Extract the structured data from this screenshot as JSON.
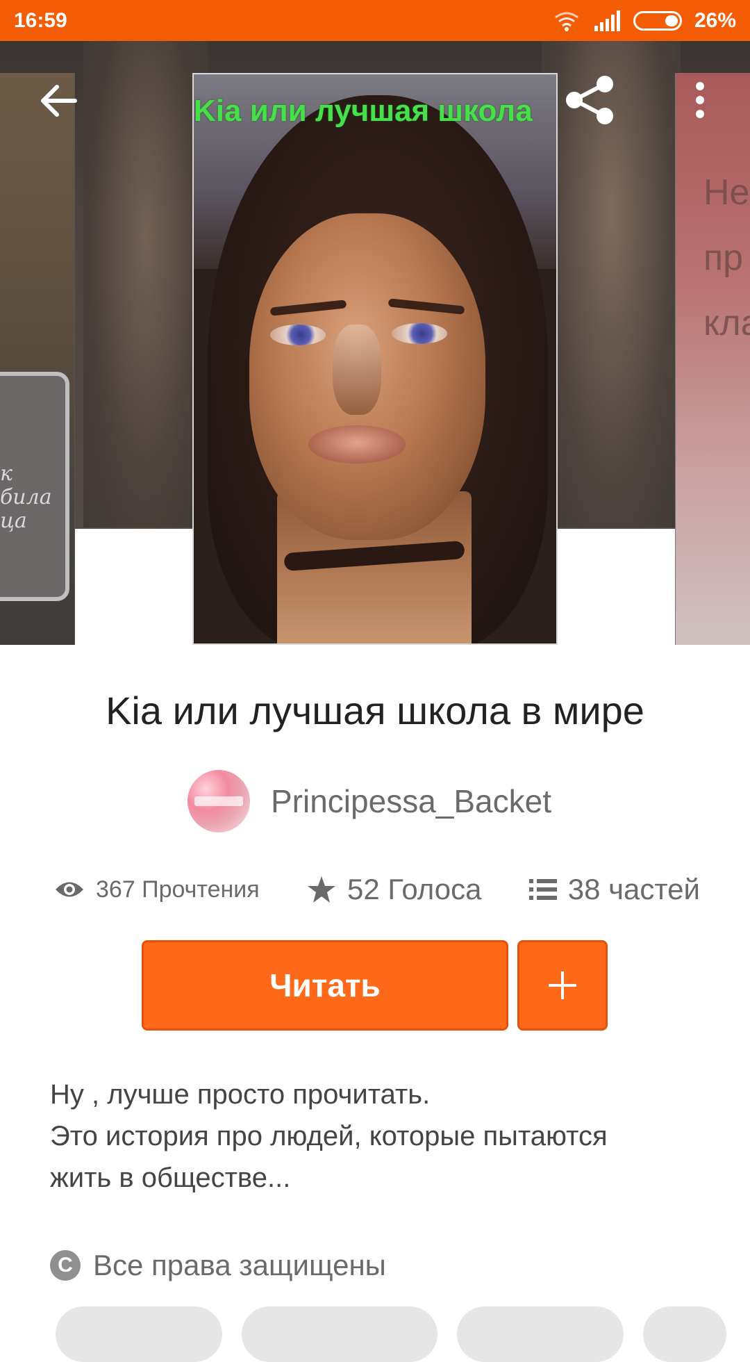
{
  "status_bar": {
    "time": "16:59",
    "battery": "26%"
  },
  "cover": {
    "title_text": "Kia или лучшая школа",
    "left_cover_text": [
      "к",
      "била",
      "ца"
    ],
    "right_cover_text": [
      "Не",
      "пр",
      "кла"
    ]
  },
  "book": {
    "title": "Kia или лучшая школа в мире",
    "author": "Principessa_Backet"
  },
  "stats": {
    "reads": "367 Прочтения",
    "votes": "52 Голоса",
    "parts": "38 частей"
  },
  "actions": {
    "read_label": "Читать",
    "add_label": "+"
  },
  "description": {
    "line1": "Ну , лучше просто прочитать.",
    "line2": "Это история про людей, которые пытаются",
    "line3": "жить в обществе..."
  },
  "copyright": {
    "symbol": "C",
    "label": "Все права защищены"
  },
  "colors": {
    "accent": "#ff6a1a",
    "status_bar": "#f45d06",
    "text_primary": "#222222",
    "text_secondary": "#6a6a6a"
  },
  "icons": {
    "back": "arrow-left-icon",
    "share": "share-icon",
    "more": "more-vertical-icon",
    "reads": "eye-icon",
    "votes": "star-icon",
    "parts": "list-icon",
    "copyright": "copyright-icon"
  }
}
